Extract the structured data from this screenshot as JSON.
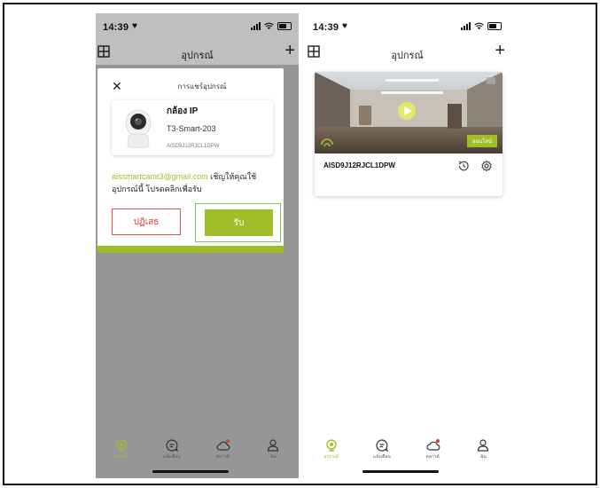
{
  "left_screen": {
    "status": {
      "time": "14:39",
      "heart": "♥"
    },
    "nav": {
      "title": "อุปกรณ์",
      "plus": "+"
    },
    "dialog": {
      "close": "✕",
      "title": "การแชร์อุปกรณ์",
      "device_name": "กล้อง IP",
      "device_model": "T3-Smart-203",
      "device_id": "AISD9J12RJCL1DPW",
      "invite_email": "aissmartcamt3@gmail.com",
      "invite_rest": " เชิญให้คุณใช้ อุปกรณ์นี้ โปรดคลิกเพื่อรับ",
      "reject_label": "ปฏิเสธ",
      "accept_label": "รับ"
    }
  },
  "right_screen": {
    "status": {
      "time": "14:39",
      "heart": "♥"
    },
    "nav": {
      "title": "อุปกรณ์",
      "plus": "+"
    },
    "camera_card": {
      "status_badge": "ออนไลน์",
      "device_id": "AISD9J12RJCL1DPW"
    }
  },
  "tabs": [
    {
      "label": "อุปกรณ์",
      "icon": "camera-icon",
      "active": true
    },
    {
      "label": "แจ้งเตือน",
      "icon": "message-icon",
      "active": false
    },
    {
      "label": "คลาวด์",
      "icon": "cloud-icon",
      "active": false
    },
    {
      "label": "ฉัน",
      "icon": "person-icon",
      "active": false
    }
  ],
  "colors": {
    "accent": "#9fbe2a",
    "reject": "#e03b3b",
    "accept_outline": "#7ec86a",
    "overlay": "#c9c9c9"
  }
}
